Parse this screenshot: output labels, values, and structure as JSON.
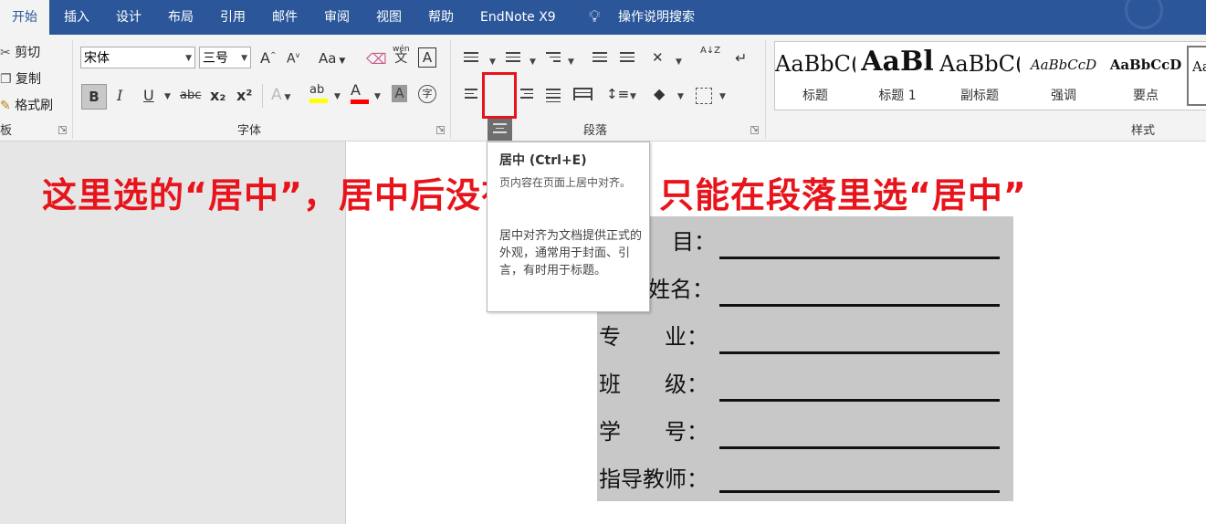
{
  "tabs": [
    {
      "label": "开始",
      "active": true
    },
    {
      "label": "插入"
    },
    {
      "label": "设计"
    },
    {
      "label": "布局"
    },
    {
      "label": "引用"
    },
    {
      "label": "邮件"
    },
    {
      "label": "审阅"
    },
    {
      "label": "视图"
    },
    {
      "label": "帮助"
    },
    {
      "label": "EndNote X9"
    }
  ],
  "tell_me": {
    "label": "操作说明搜索",
    "icon": "lightbulb-icon"
  },
  "clipboard": {
    "cut": "剪切",
    "copy": "复制",
    "format_painter": "格式刷",
    "group_label": "板"
  },
  "font": {
    "name": "宋体",
    "size": "三号",
    "group_label": "字体",
    "grow": "A",
    "shrink": "A",
    "change_case": "Aa",
    "phonetic_top": "wén",
    "phonetic_bottom": "文",
    "border_char": "A",
    "bold": "B",
    "italic": "I",
    "underline": "U",
    "strike": "abc",
    "subscript": "x₂",
    "superscript": "x²",
    "effects": "A",
    "highlight": "ab",
    "font_color": "A",
    "shading_char": "A",
    "enclose": "字"
  },
  "paragraph": {
    "group_label": "段落",
    "sort": "A↓Z"
  },
  "styles": {
    "group_label": "样式",
    "items": [
      {
        "preview": "AaBbC(",
        "name": "标题"
      },
      {
        "preview": "AaBl",
        "name": "标题 1"
      },
      {
        "preview": "AaBbC(",
        "name": "副标题"
      },
      {
        "preview": "AaBbCcD",
        "name": "强调"
      },
      {
        "preview": "AaBbCcD",
        "name": "要点"
      },
      {
        "preview": "Aa",
        "name": ""
      }
    ]
  },
  "tooltip": {
    "title": "居中 (Ctrl+E)",
    "ghost": "页内容在页面上居中对齐。",
    "description": "居中对齐为文档提供正式的外观，通常用于封面、引言，有时用于标题。"
  },
  "annotation": "这里选的“居中”，居中后没有下划线，只能在段落里选“居中”",
  "form_fields": [
    {
      "label": "目：",
      "label_offset": "partial"
    },
    {
      "label": "姓名：",
      "label_offset": "partial"
    },
    {
      "label": "专　　业："
    },
    {
      "label": "班　　级："
    },
    {
      "label": "学　　号："
    },
    {
      "label": "指导教师："
    }
  ],
  "colors": {
    "ribbon_blue": "#2b579a",
    "annotation_red": "#e8141b",
    "highlight_yellow": "#ffff00",
    "font_red": "#ff0000"
  }
}
